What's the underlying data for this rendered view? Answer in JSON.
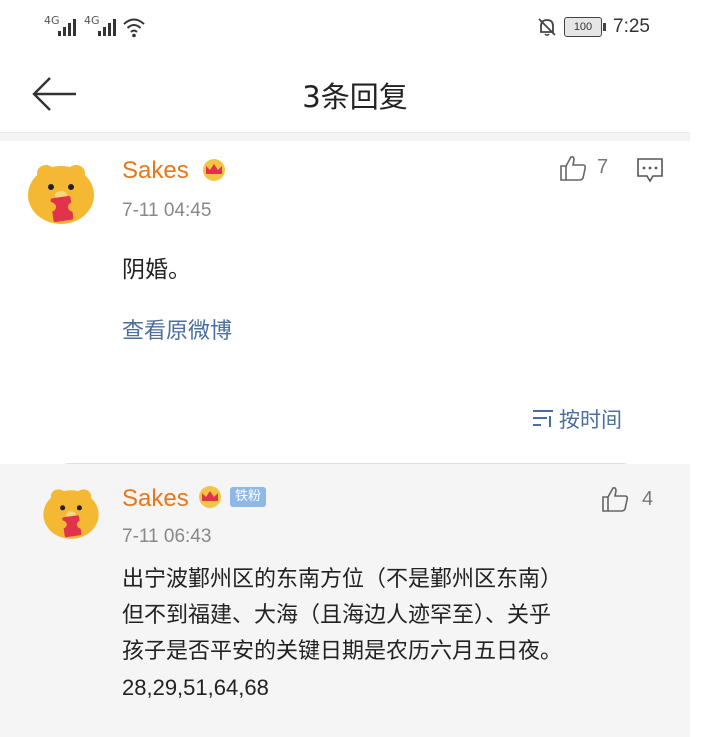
{
  "status_bar": {
    "signal1": "4G",
    "signal2": "4G",
    "battery": "100",
    "time": "7:25"
  },
  "header": {
    "title": "3条回复"
  },
  "main_comment": {
    "author": "Sakes",
    "date": "7-11 04:45",
    "text": "阴婚。",
    "likes": "7",
    "view_original": "查看原微博",
    "sort_label": "按时间"
  },
  "reply": {
    "author": "Sakes",
    "badge": "铁粉",
    "date": "7-11 06:43",
    "likes": "4",
    "lines": [
      "出宁波鄞州区的东南方位（不是鄞州区东南）",
      "但不到福建、大海（且海边人迹罕至）、关乎",
      "孩子是否平安的关键日期是农历六月五日夜。",
      "28,29,51,64,68"
    ]
  },
  "colors": {
    "username": "#e8761a",
    "link": "#4a6f9e",
    "badge": "#8db8e8"
  },
  "icons": [
    "back-arrow-icon",
    "like-icon",
    "reply-icon",
    "sort-icon",
    "mute-bell-icon",
    "wifi-icon",
    "crown-icon"
  ]
}
